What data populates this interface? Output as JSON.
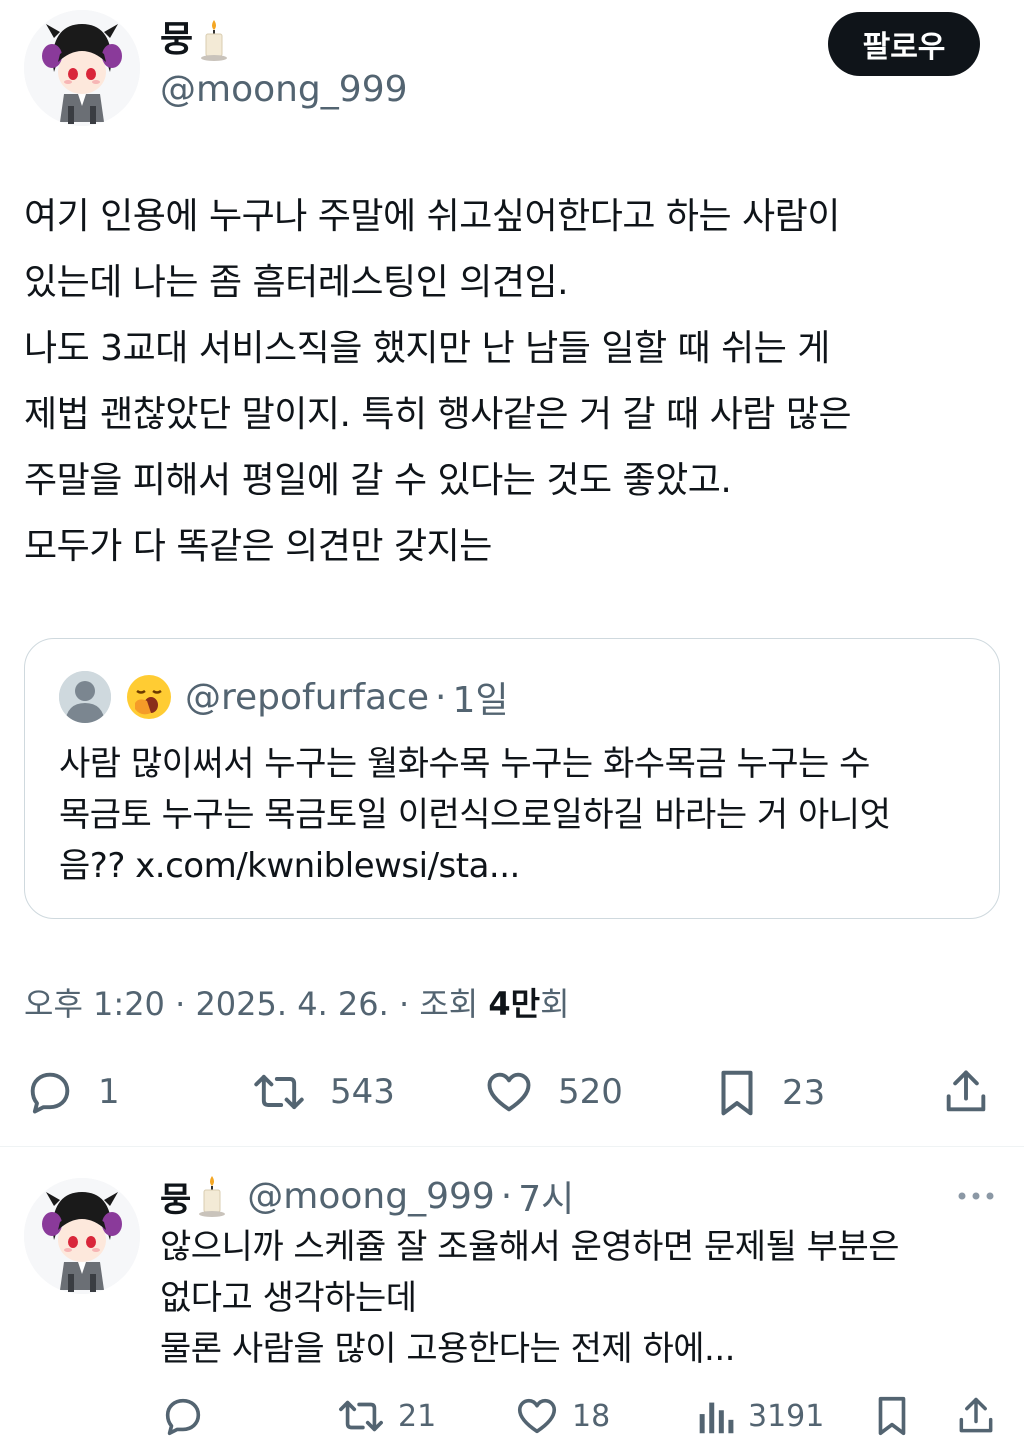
{
  "author": {
    "name": "뭉",
    "handle": "@moong_999",
    "follow_label": "팔로우"
  },
  "post": {
    "lines": [
      "여기 인용에 누구나 주말에 쉬고싶어한다고 하는 사람이",
      "있는데 나는 좀 흠터레스팅인 의견임.",
      "나도 3교대 서비스직을 했지만 난 남들 일할 때 쉬는 게",
      "제법 괜찮았단 말이지. 특히 행사같은 거 갈 때 사람 많은",
      "주말을 피해서 평일에 갈 수 있다는 것도 좋았고.",
      "모두가 다 똑같은 의견만 갖지는"
    ]
  },
  "quote": {
    "handle": "@repofurface",
    "dot": "·",
    "time": "1일",
    "emoji_icon": "yawning-face-icon",
    "lines": [
      "사람 많이써서 누구는 월화수목 누구는 화수목금 누구는 수",
      "목금토 누구는 목금토일 이런식으로일하길 바라는 거 아니엇",
      "음?? x.com/kwniblewsi/sta..."
    ]
  },
  "meta": {
    "time": "오후 1:20",
    "sep": "·",
    "date": "2025. 4. 26.",
    "views_label": "조회",
    "views_count": "4만",
    "views_suffix": "회"
  },
  "actions": {
    "replies": "1",
    "retweets": "543",
    "likes": "520",
    "bookmarks": "23"
  },
  "reply": {
    "name": "뭉",
    "handle": "@moong_999",
    "dot": "·",
    "time": "7시",
    "lines": [
      "않으니까 스케쥴 잘 조율해서 운영하면 문제될 부분은",
      "없다고 생각하는데",
      "물론 사람을 많이 고용한다는 전제 하에..."
    ],
    "retweets": "21",
    "likes": "18",
    "views": "3191"
  },
  "colors": {
    "text": "#0f1419",
    "secondary": "#536471",
    "border": "#cfd9de",
    "button_bg": "#0f1419"
  }
}
